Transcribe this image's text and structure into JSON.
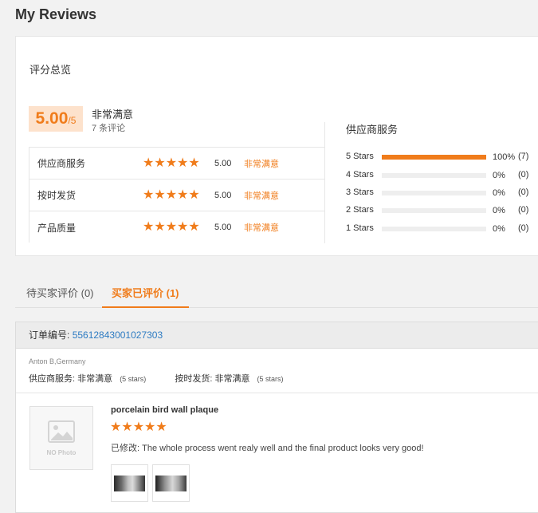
{
  "page": {
    "title": "My Reviews"
  },
  "summary": {
    "heading": "评分总览",
    "score": "5.00",
    "score_max": "/5",
    "overall_label": "非常满意",
    "review_count": "7 条评论",
    "metrics": [
      {
        "name": "供应商服务",
        "stars": "★★★★★",
        "rating": 5,
        "score": "5.00",
        "word": "非常满意"
      },
      {
        "name": "按时发货",
        "stars": "★★★★★",
        "rating": 5,
        "score": "5.00",
        "word": "非常满意"
      },
      {
        "name": "产品质量",
        "stars": "★★★★★",
        "rating": 5,
        "score": "5.00",
        "word": "非常满意"
      }
    ]
  },
  "distribution": {
    "title": "供应商服务",
    "rows": [
      {
        "label": "5  Stars",
        "fraction": 1.0,
        "percent": "100%",
        "count": "(7)"
      },
      {
        "label": "4  Stars",
        "fraction": 0.0,
        "percent": "0%",
        "count": "(0)"
      },
      {
        "label": "3  Stars",
        "fraction": 0.0,
        "percent": "0%",
        "count": "(0)"
      },
      {
        "label": "2  Stars",
        "fraction": 0.0,
        "percent": "0%",
        "count": "(0)"
      },
      {
        "label": "1  Stars",
        "fraction": 0.0,
        "percent": "0%",
        "count": "(0)"
      }
    ]
  },
  "tabs": [
    {
      "label": "待买家评价 (0)",
      "active": false
    },
    {
      "label": "买家已评价 (1)",
      "active": true
    }
  ],
  "order": {
    "number_label": "订单编号:",
    "number": "55612843001027303",
    "buyer": "Anton B,Germany",
    "supplier_service_label": "供应商服务:",
    "supplier_service_value": "非常满意",
    "supplier_service_stars": "(5 stars)",
    "shipping_label": "按时发货:",
    "shipping_value": "非常满意",
    "shipping_stars": "(5 stars)",
    "thumb_text": "NO Photo",
    "product_title": "porcelain bird wall plaque",
    "review_stars": "★★★★★",
    "review_rating": 5,
    "review_text": "已修改: The whole process went realy well and the final product looks very good!"
  },
  "colors": {
    "accent": "#f07c1b",
    "link": "#2d7bc2",
    "score_bg": "#fde2cc"
  }
}
